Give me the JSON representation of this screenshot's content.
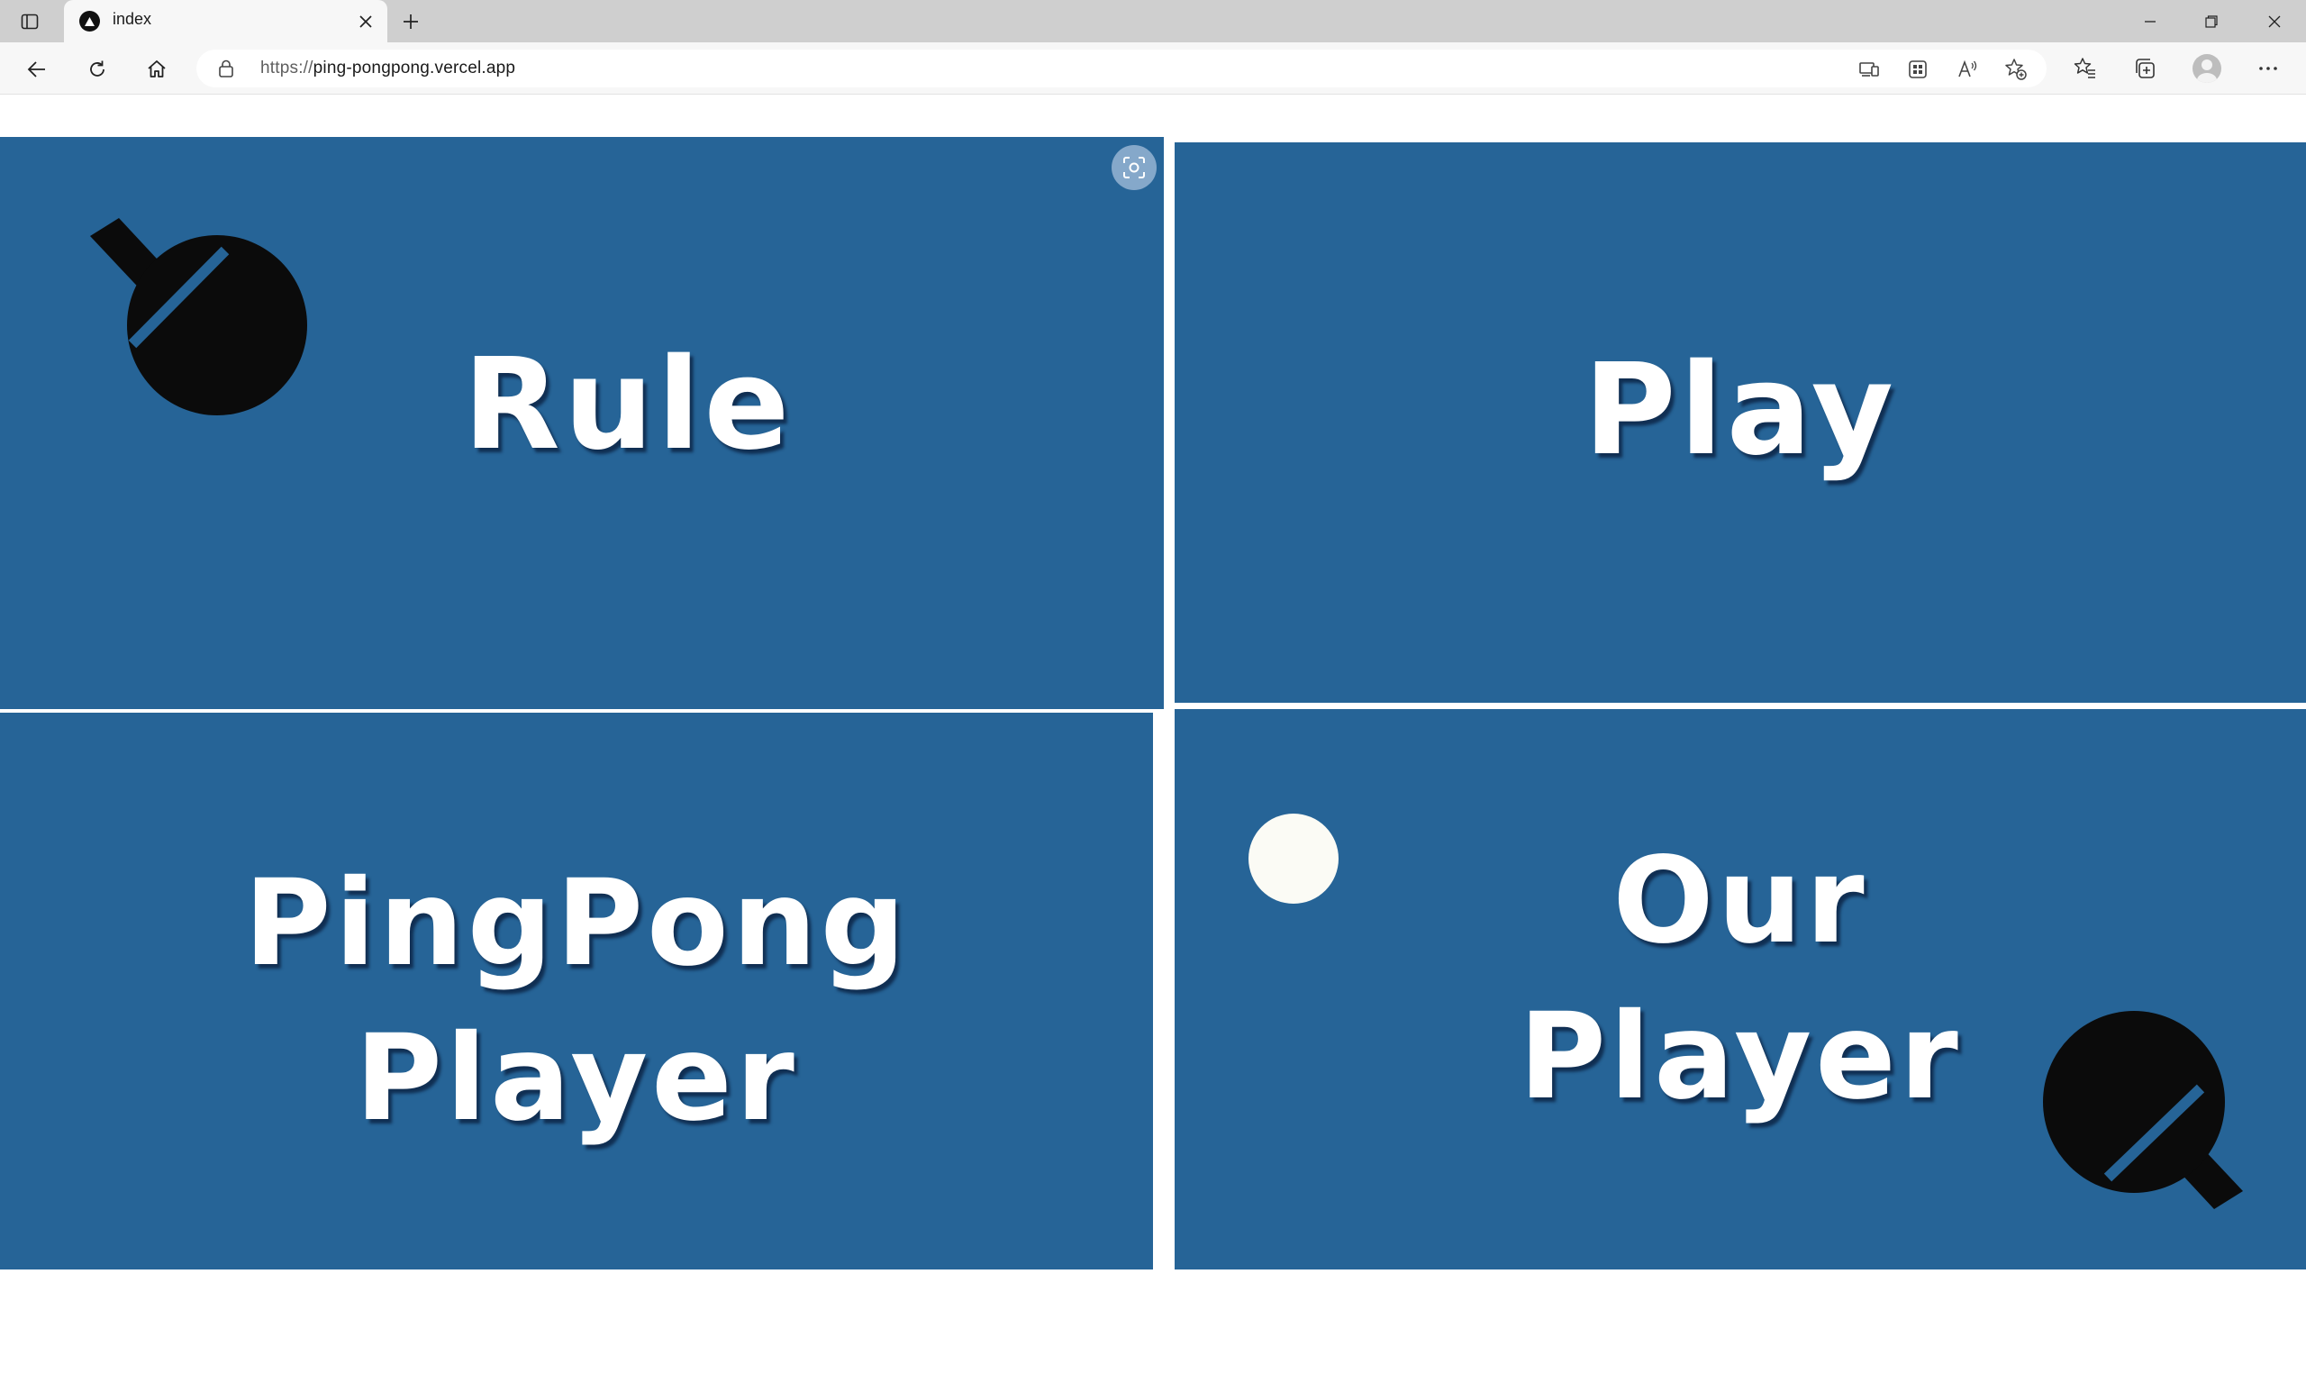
{
  "browser": {
    "tab": {
      "title": "index"
    },
    "address": {
      "scheme": "https://",
      "host": "ping-pongpong.vercel.app"
    }
  },
  "page": {
    "panels": {
      "rule": {
        "label": "Rule"
      },
      "play": {
        "label": "Play"
      },
      "pingpong_player": {
        "line1": "PingPong",
        "line2": "Player"
      },
      "our_player": {
        "line1": "Our",
        "line2": "Player"
      }
    }
  },
  "icons": {
    "paddle": "ping-pong-paddle-icon",
    "ball": "ping-pong-ball-icon"
  },
  "colors": {
    "panel_bg": "#266497",
    "text": "#ffffff",
    "paddle": "#0b0b0b",
    "ball": "#fbfbf5"
  }
}
